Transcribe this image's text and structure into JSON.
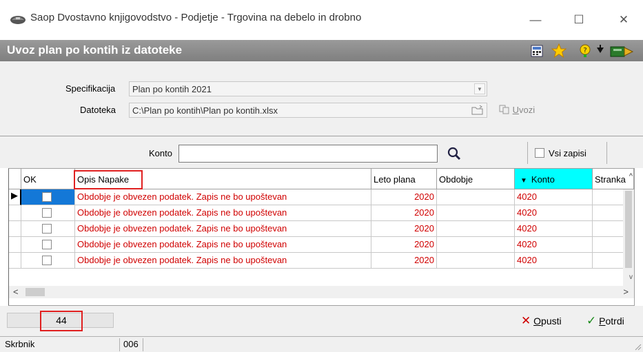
{
  "window": {
    "title": "Saop Dvostavno knjigovodstvo - Podjetje - Trgovina na debelo in drobno",
    "minimize": "—",
    "maximize": "☐",
    "close": "✕"
  },
  "header": {
    "title": "Uvoz plan po kontih iz datoteke",
    "icons": [
      "calculator-icon",
      "star-icon",
      "help-icon",
      "arrow-icon",
      "exit-icon"
    ]
  },
  "form": {
    "specifikacija_label": "Specifikacija",
    "specifikacija_value": "Plan po kontih 2021",
    "datoteka_label": "Datoteka",
    "datoteka_value": "C:\\Plan po kontih\\Plan po kontih.xlsx",
    "uvozi_prefix": "U",
    "uvozi_rest": "vozi"
  },
  "search": {
    "konto_label": "Konto",
    "konto_value": "",
    "vsi_zapisi_label": "Vsi zapisi"
  },
  "grid": {
    "columns": [
      "OK",
      "Opis Napake",
      "Leto plana",
      "Obdobje",
      "Konto",
      "Stranka"
    ],
    "rows": [
      {
        "ok": "",
        "opis": "Obdobje je obvezen podatek. Zapis ne bo upoštevan",
        "leto": "2020",
        "obdobje": "",
        "konto": "4020",
        "stranka": ""
      },
      {
        "ok": "",
        "opis": "Obdobje je obvezen podatek. Zapis ne bo upoštevan",
        "leto": "2020",
        "obdobje": "",
        "konto": "4020",
        "stranka": ""
      },
      {
        "ok": "",
        "opis": "Obdobje je obvezen podatek. Zapis ne bo upoštevan",
        "leto": "2020",
        "obdobje": "",
        "konto": "4020",
        "stranka": ""
      },
      {
        "ok": "",
        "opis": "Obdobje je obvezen podatek. Zapis ne bo upoštevan",
        "leto": "2020",
        "obdobje": "",
        "konto": "4020",
        "stranka": ""
      },
      {
        "ok": "",
        "opis": "Obdobje je obvezen podatek. Zapis ne bo upoštevan",
        "leto": "2020",
        "obdobje": "",
        "konto": "4020",
        "stranka": ""
      }
    ]
  },
  "footer": {
    "count": "44",
    "opusti_prefix": "O",
    "opusti_rest": "pusti",
    "potrdi_prefix": "P",
    "potrdi_rest": "otrdi"
  },
  "status": {
    "field1": "Skrbnik",
    "field2": "006"
  },
  "colors": {
    "error_text": "#d00000",
    "highlight_box": "#e02020",
    "konto_header": "#00ffff",
    "header_bar": "#8a8a8a"
  }
}
